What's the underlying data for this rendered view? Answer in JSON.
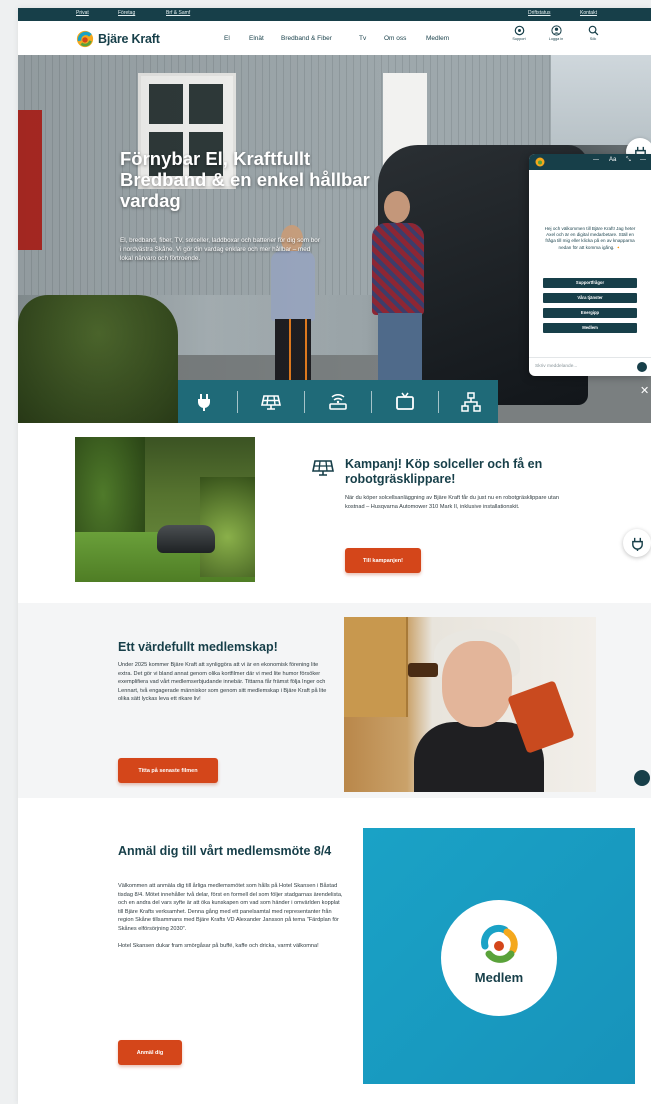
{
  "topbar": {
    "links": [
      "Privat",
      "Företag",
      "Brf & Samf"
    ],
    "right_links": [
      "Driftstatus",
      "Kontakt"
    ]
  },
  "header": {
    "logo_text": "Bjäre Kraft",
    "nav": [
      "El",
      "Elnät",
      "Bredband & Fiber",
      "Tv",
      "Om oss",
      "Medlem"
    ],
    "icons": [
      {
        "icon": "support-icon",
        "label": "Support"
      },
      {
        "icon": "user-icon",
        "label": "Logga in"
      },
      {
        "icon": "search-icon",
        "label": "Sök"
      }
    ]
  },
  "hero": {
    "title": "Förnybar El, Kraftfullt Bredband & en enkel hållbar vardag",
    "subtitle": "El, bredband, fiber, TV, solceller, laddboxar och batterier för dig som bor i nordvästra Skåne. Vi gör din vardag enklare och mer hållbar – med lokal närvaro och förtroende."
  },
  "categories": [
    "el-plug-icon",
    "solar-panel-icon",
    "router-icon",
    "tv-icon",
    "network-icon"
  ],
  "chat": {
    "controls": [
      "—",
      "Aa",
      "⤡",
      "—"
    ],
    "message": "Hej och välkommen till Bjäre Kraft! Jag heter Axel och är en digital medarbetare. Ställ en fråga till mig eller klicka på en av knapparna nedan för att komma igång. 🔸",
    "buttons": [
      "Supportfrågor",
      "Våra tjänster",
      "Energipp",
      "Medlem"
    ],
    "input_placeholder": "Skriv meddelande..."
  },
  "campaign": {
    "title": "Kampanj! Köp solceller och få en robotgräsklippare!",
    "text": "När du köper solcellsanläggning av Bjäre Kraft får du just nu en robotgräsklippare utan kostnad – Husqvarna Automower 310 Mark II, inklusive installationskit.",
    "button": "Till kampanjen!"
  },
  "membership": {
    "title": "Ett värdefullt medlemskap!",
    "text": "Under 2025 kommer Bjäre Kraft att synliggöra att vi är en ekonomisk förening lite extra. Det gör vi bland annat genom olika kortfilmer där vi med lite humor försöker exemplifiera vad vårt medlemserbjudande innebär. Tittarna får främst följa Inger och Lennart, två engagerade människor som genom sitt medlemskap i Bjäre Kraft på lite olika sätt lyckas leva ett rikare liv!",
    "button": "Titta på senaste filmen"
  },
  "meeting": {
    "title": "Anmäl dig till vårt medlemsmöte 8/4",
    "text": "Välkommen att anmäla dig till årliga medlemsmötet som hålls på Hotel Skansen i Båstad tisdag 8/4. Mötet innehåller två delar, först en formell del som följer stadgarnas ärendelista, och en andra del vars syfte är att öka kunskapen om vad som händer i omvärlden kopplat till Bjäre Krafts verksamhet. Denna gång med ett panelsamtal med representanter från region Skåne tillsammans med Bjäre Krafts VD Alexander Jansson på tema \"Färdplan för Skånes elförsörjning 2030\".",
    "text2": "Hotel Skansen dukar fram smörgåsar på buffé, kaffe och dricka, varmt välkomna!",
    "button": "Anmäl dig",
    "image_text": "Medlem"
  },
  "colors": {
    "brand_dark": "#173f49",
    "accent_orange": "#d4461a",
    "teal_bar": "#1f6a78",
    "medlem_blue": "#1793bb"
  }
}
